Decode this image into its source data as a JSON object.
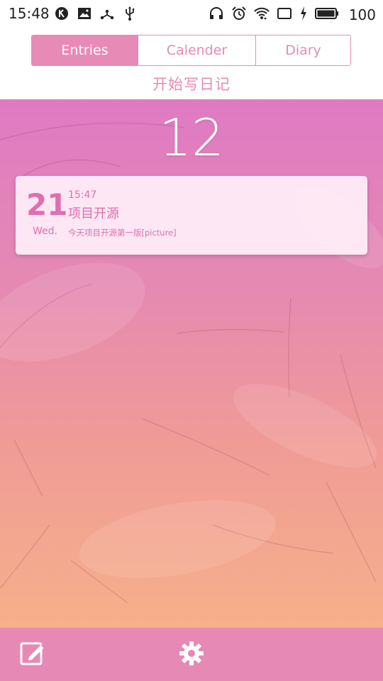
{
  "status_bar": {
    "time": "15:48",
    "battery": "100",
    "left_icons": [
      "k-badge-icon",
      "image-icon",
      "network-icon",
      "usb-icon"
    ],
    "right_icons": [
      "headset-icon",
      "alarm-icon",
      "wifi-icon",
      "tablet-icon",
      "charging-icon",
      "battery-icon"
    ]
  },
  "tabs": [
    {
      "label": "Entries",
      "active": true
    },
    {
      "label": "Calender",
      "active": false
    },
    {
      "label": "Diary",
      "active": false
    }
  ],
  "start_writing": "开始写日记",
  "month_number": "12",
  "entries": [
    {
      "day": "21",
      "weekday": "Wed.",
      "time": "15:47",
      "title": "项目开源",
      "summary": "今天项目开源第一版[picture]"
    }
  ],
  "bottom_bar": {
    "icons": [
      "compose-icon",
      "gear-icon"
    ]
  },
  "colors": {
    "accent": "#e88ab6",
    "card_text": "#df6fae",
    "bottom_bar": "#e789b5"
  }
}
